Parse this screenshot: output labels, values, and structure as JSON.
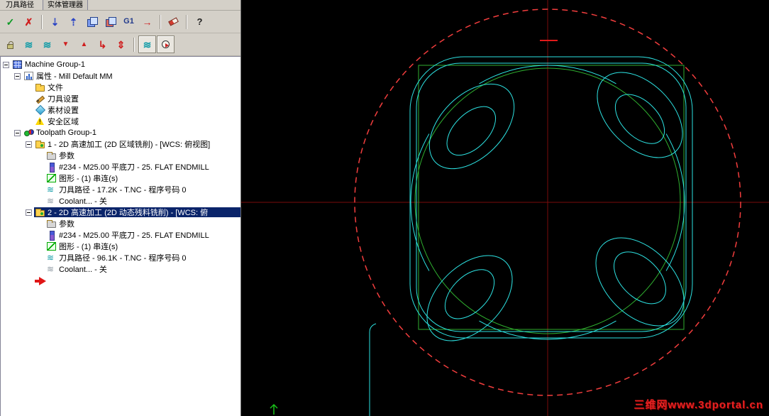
{
  "colors": {
    "select_blue": "#0a246a",
    "cyan": "#2de2e2",
    "green": "#2fae2f",
    "dash_red": "#f23d3d",
    "cross_red": "#7a0d0d",
    "watermark_red": "#e32222"
  },
  "panel": {
    "tabs": [
      {
        "label": "刀具路径"
      },
      {
        "label": "实体管理器"
      }
    ],
    "toolbar_main": [
      {
        "name": "select-all-operations",
        "glyph": "✓"
      },
      {
        "name": "unselect-all-operations",
        "glyph": "✗"
      },
      {
        "name": "regenerate-selected-operations",
        "glyph": "⇣"
      },
      {
        "name": "regenerate-all-operations",
        "glyph": "⇡"
      },
      {
        "name": "backplot-operations"
      },
      {
        "name": "verify-operations"
      },
      {
        "name": "post-operations",
        "glyph": "G1"
      },
      {
        "name": "highfeed-operations",
        "glyph": "→"
      },
      {
        "name": "delete-operations"
      },
      {
        "name": "help",
        "glyph": "?"
      }
    ],
    "toolbar_display": [
      {
        "name": "lock-operations"
      },
      {
        "name": "toggle-toolpath-display",
        "glyph": "≋"
      },
      {
        "name": "toggle-selected-display",
        "glyph": "≋"
      },
      {
        "name": "move-insert-down",
        "glyph": "▼"
      },
      {
        "name": "move-insert-up",
        "glyph": "▲"
      },
      {
        "name": "move-insert-special",
        "glyph": "↳"
      },
      {
        "name": "scroll-insert",
        "glyph": "⇕"
      },
      {
        "name": "display-options",
        "glyph": "≋"
      },
      {
        "name": "simulate-options"
      }
    ]
  },
  "tree": {
    "items": [
      {
        "label": "Machine Group-1",
        "icon": "machine-group-icon"
      },
      {
        "label": "属性 - Mill Default MM",
        "icon": "properties-icon"
      },
      {
        "label": "文件",
        "icon": "folder-icon"
      },
      {
        "label": "刀具设置",
        "icon": "tool-settings-icon"
      },
      {
        "label": "素材设置",
        "icon": "stock-setup-icon"
      },
      {
        "label": "安全区域",
        "icon": "safety-zone-icon"
      },
      {
        "label": "Toolpath Group-1",
        "icon": "toolpath-group-icon"
      },
      {
        "label": "1 - 2D 高速加工 (2D 区域铣削) - [WCS: 俯视图]",
        "icon": "operation-folder-icon"
      },
      {
        "label": "参数",
        "icon": "parameters-icon"
      },
      {
        "label": "#234 - M25.00 平底刀 - 25. FLAT ENDMILL",
        "icon": "tool-icon"
      },
      {
        "label": "图形 - (1) 串连(s)",
        "icon": "geometry-icon"
      },
      {
        "label": "刀具路径 - 17.2K - T.NC - 程序号码 0",
        "icon": "toolpath-icon"
      },
      {
        "label": "Coolant... - 关",
        "icon": "coolant-icon"
      },
      {
        "label": "2 - 2D 高速加工 (2D 动态残料铣削) - [WCS: 俯",
        "icon": "operation-folder-icon"
      },
      {
        "label": "参数",
        "icon": "parameters-icon"
      },
      {
        "label": "#234 - M25.00 平底刀 - 25. FLAT ENDMILL",
        "icon": "tool-icon"
      },
      {
        "label": "图形 - (1) 串连(s)",
        "icon": "geometry-icon"
      },
      {
        "label": "刀具路径 - 96.1K - T.NC - 程序号码 0",
        "icon": "toolpath-icon"
      },
      {
        "label": "Coolant... - 关",
        "icon": "coolant-icon"
      }
    ]
  },
  "viewport": {
    "watermark": "三维网www.3dportal.cn"
  }
}
